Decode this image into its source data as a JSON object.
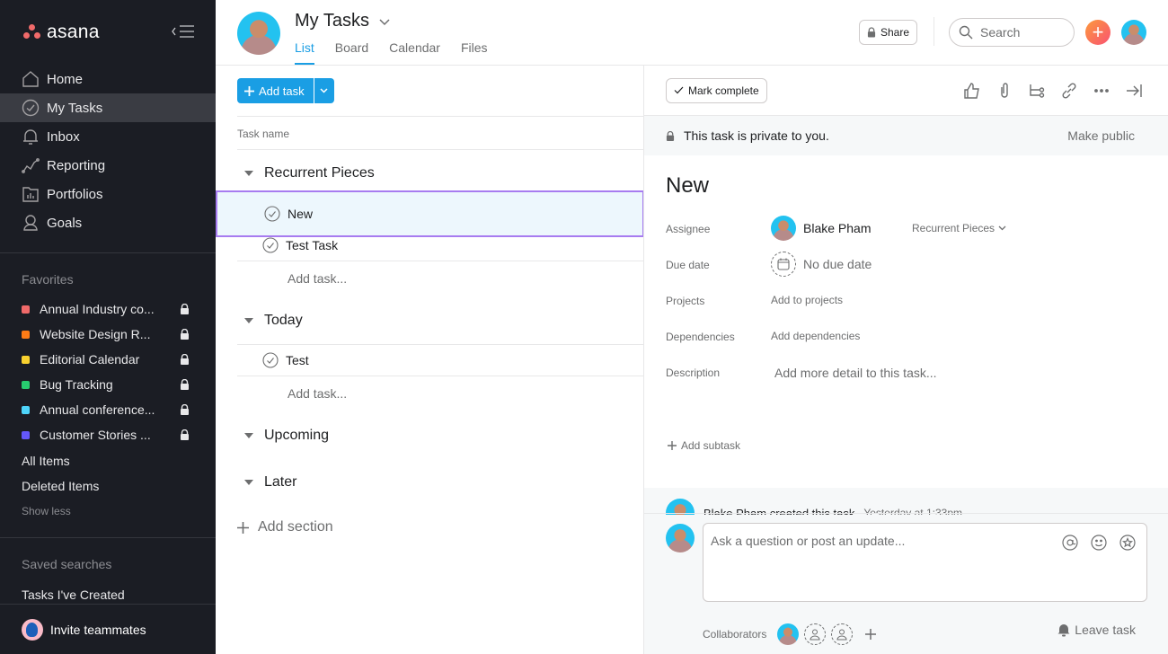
{
  "sidebar": {
    "brand": "asana",
    "nav": [
      {
        "label": "Home",
        "icon": "home-icon"
      },
      {
        "label": "My Tasks",
        "icon": "check-circle-icon",
        "active": true
      },
      {
        "label": "Inbox",
        "icon": "bell-icon"
      },
      {
        "label": "Reporting",
        "icon": "line-chart-icon"
      },
      {
        "label": "Portfolios",
        "icon": "portfolio-icon"
      },
      {
        "label": "Goals",
        "icon": "goals-icon"
      }
    ],
    "favorites_heading": "Favorites",
    "favorites": [
      {
        "label": "Annual Industry co...",
        "color": "#f06a6a",
        "private": true
      },
      {
        "label": "Website Design R...",
        "color": "#fd7b16",
        "private": true
      },
      {
        "label": "Editorial Calendar",
        "color": "#f8d12f",
        "private": true
      },
      {
        "label": "Bug Tracking",
        "color": "#27cb6f",
        "private": true
      },
      {
        "label": "Annual conference...",
        "color": "#4ed4f9",
        "private": true
      },
      {
        "label": "Customer Stories ...",
        "color": "#6457f9",
        "private": true
      }
    ],
    "all_items": "All Items",
    "deleted_items": "Deleted Items",
    "show_less": "Show less",
    "saved_searches_heading": "Saved searches",
    "saved_searches": [
      "Tasks I've Created"
    ],
    "invite": "Invite teammates"
  },
  "header": {
    "title": "My Tasks",
    "tabs": [
      {
        "label": "List",
        "active": true
      },
      {
        "label": "Board"
      },
      {
        "label": "Calendar"
      },
      {
        "label": "Files"
      }
    ],
    "share_label": "Share",
    "search_placeholder": "Search"
  },
  "list": {
    "add_task_label": "Add task",
    "column_header": "Task name",
    "add_task_placeholder": "Add task...",
    "sections": [
      {
        "name": "Recurrent Pieces",
        "tasks": [
          {
            "name": "New",
            "selected": true
          },
          {
            "name": "Test Task"
          }
        ]
      },
      {
        "name": "Today",
        "tasks": [
          {
            "name": "Test"
          }
        ]
      },
      {
        "name": "Upcoming",
        "tasks": []
      },
      {
        "name": "Later",
        "tasks": []
      }
    ],
    "add_section_label": "Add section"
  },
  "detail": {
    "mark_complete": "Mark complete",
    "private_notice": "This task is private to you.",
    "make_public": "Make public",
    "title": "New",
    "fields": {
      "assignee_label": "Assignee",
      "assignee": "Blake Pham",
      "assignee_project": "Recurrent Pieces",
      "due_label": "Due date",
      "due": "No due date",
      "projects_label": "Projects",
      "projects": "Add to projects",
      "dependencies_label": "Dependencies",
      "dependencies": "Add dependencies",
      "description_label": "Description",
      "description_placeholder": "Add more detail to this task..."
    },
    "add_subtask": "Add subtask",
    "story": {
      "text": "Blake Pham created this task",
      "time": "Yesterday at 1:33pm"
    },
    "comment_placeholder": "Ask a question or post an update...",
    "collaborators_label": "Collaborators",
    "leave_task": "Leave task"
  }
}
